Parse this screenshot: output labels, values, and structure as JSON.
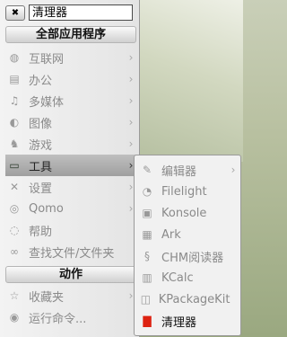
{
  "search": {
    "value": "清理器"
  },
  "headers": {
    "all_apps": "全部应用程序",
    "actions": "动作"
  },
  "menu_items": [
    {
      "label": "互联网",
      "icon": "globe-icon",
      "glyph": "◍",
      "arrow": "›"
    },
    {
      "label": "办公",
      "icon": "office-icon",
      "glyph": "▤",
      "arrow": "›"
    },
    {
      "label": "多媒体",
      "icon": "multimedia-icon",
      "glyph": "♫",
      "arrow": "›"
    },
    {
      "label": "图像",
      "icon": "graphics-icon",
      "glyph": "◐",
      "arrow": "›"
    },
    {
      "label": "游戏",
      "icon": "games-icon",
      "glyph": "♞",
      "arrow": "›"
    },
    {
      "label": "工具",
      "icon": "terminal-icon",
      "glyph": "▭",
      "arrow": "›"
    },
    {
      "label": "设置",
      "icon": "settings-icon",
      "glyph": "✕",
      "arrow": "›"
    },
    {
      "label": "Qomo",
      "icon": "qomo-icon",
      "glyph": "◎",
      "arrow": "›"
    },
    {
      "label": "帮助",
      "icon": "help-icon",
      "glyph": "◌",
      "arrow": ""
    },
    {
      "label": "查找文件/文件夹",
      "icon": "binoculars-icon",
      "glyph": "∞",
      "arrow": ""
    }
  ],
  "action_items": [
    {
      "label": "收藏夹",
      "icon": "star-icon",
      "glyph": "☆",
      "arrow": "›"
    },
    {
      "label": "运行命令...",
      "icon": "run-icon",
      "glyph": "◉",
      "arrow": ""
    }
  ],
  "submenu_items": [
    {
      "label": "编辑器",
      "icon": "editor-icon",
      "glyph": "✎",
      "arrow": "›"
    },
    {
      "label": "Filelight",
      "icon": "filelight-icon",
      "glyph": "◔",
      "arrow": ""
    },
    {
      "label": "Konsole",
      "icon": "konsole-icon",
      "glyph": "▣",
      "arrow": ""
    },
    {
      "label": "Ark",
      "icon": "ark-icon",
      "glyph": "▦",
      "arrow": ""
    },
    {
      "label": "CHM阅读器",
      "icon": "chm-icon",
      "glyph": "§",
      "arrow": ""
    },
    {
      "label": "KCalc",
      "icon": "kcalc-icon",
      "glyph": "▥",
      "arrow": ""
    },
    {
      "label": "KPackageKit",
      "icon": "package-icon",
      "glyph": "◫",
      "arrow": ""
    },
    {
      "label": "清理器",
      "icon": "cleaner-icon",
      "glyph": "▇",
      "arrow": ""
    }
  ]
}
